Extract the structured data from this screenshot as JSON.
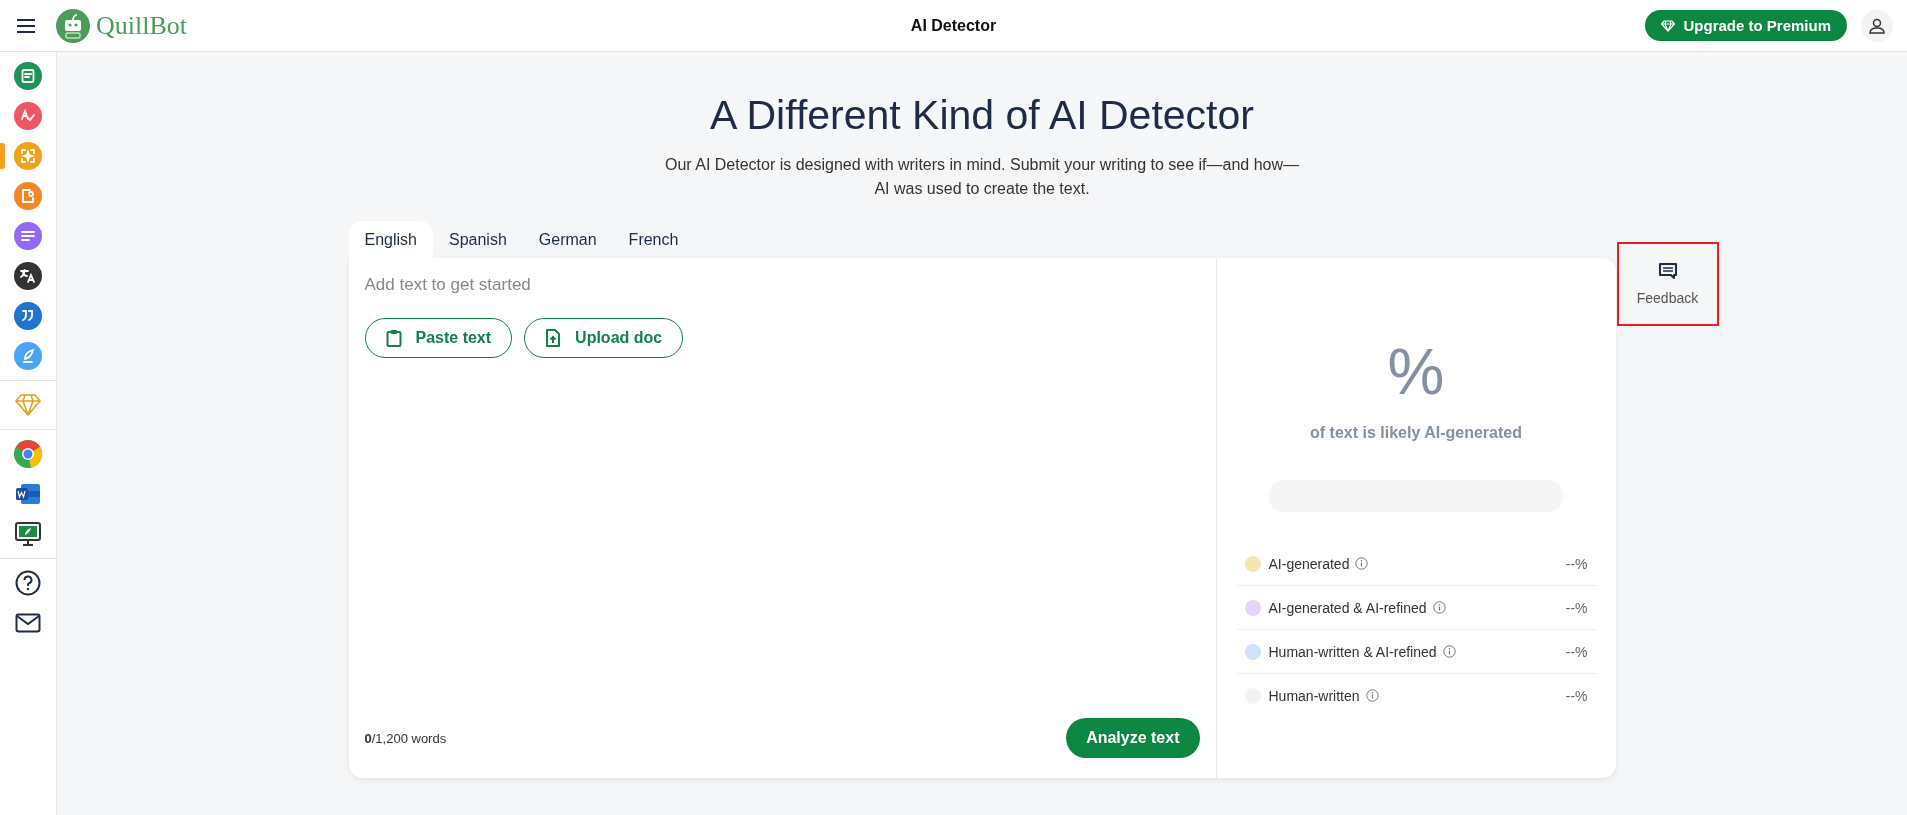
{
  "header": {
    "brand": "QuillBot",
    "title": "AI Detector",
    "upgrade_button": "Upgrade to Premium"
  },
  "sidebar": {
    "groups": [
      {
        "items": [
          {
            "kind": "paraphraser",
            "selected": false
          },
          {
            "kind": "grammar",
            "selected": false
          },
          {
            "kind": "detector",
            "selected": true
          },
          {
            "kind": "plagiarism",
            "selected": false
          },
          {
            "kind": "summarizer",
            "selected": false
          },
          {
            "kind": "translator",
            "selected": false
          },
          {
            "kind": "citation",
            "selected": false
          },
          {
            "kind": "writer",
            "selected": false
          }
        ]
      },
      {
        "items": [
          {
            "kind": "premium",
            "selected": false
          }
        ]
      },
      {
        "items": [
          {
            "kind": "chrome",
            "selected": false
          },
          {
            "kind": "word",
            "selected": false
          },
          {
            "kind": "desktop",
            "selected": false
          }
        ]
      },
      {
        "items": [
          {
            "kind": "help",
            "selected": false
          },
          {
            "kind": "mail",
            "selected": false
          }
        ]
      }
    ]
  },
  "hero": {
    "title": "A Different Kind of AI Detector",
    "subtitle": "Our AI Detector is designed with writers in mind. Submit your writing to see if—and how—AI was used to create the text."
  },
  "tabs": [
    {
      "label": "English",
      "selected": true
    },
    {
      "label": "Spanish",
      "selected": false
    },
    {
      "label": "German",
      "selected": false
    },
    {
      "label": "French",
      "selected": false
    }
  ],
  "editor": {
    "placeholder": "Add text to get started",
    "paste_button": "Paste text",
    "upload_button": "Upload doc",
    "word_count": "**0**/1,200 words",
    "analyze_button": "Analyze text"
  },
  "result": {
    "percent": "%",
    "caption": "of text is likely AI-generated",
    "legend": [
      {
        "label": "AI-generated",
        "color": "#f3e4b4",
        "value": "--%"
      },
      {
        "label": "AI-generated & AI-refined",
        "color": "#e4d3fb",
        "value": "--%"
      },
      {
        "label": "Human-written & AI-refined",
        "color": "#cfe1fd",
        "value": "--%"
      },
      {
        "label": "Human-written",
        "color": "#f2f2f2",
        "value": "--%"
      }
    ]
  },
  "feedback": {
    "label": "Feedback"
  }
}
